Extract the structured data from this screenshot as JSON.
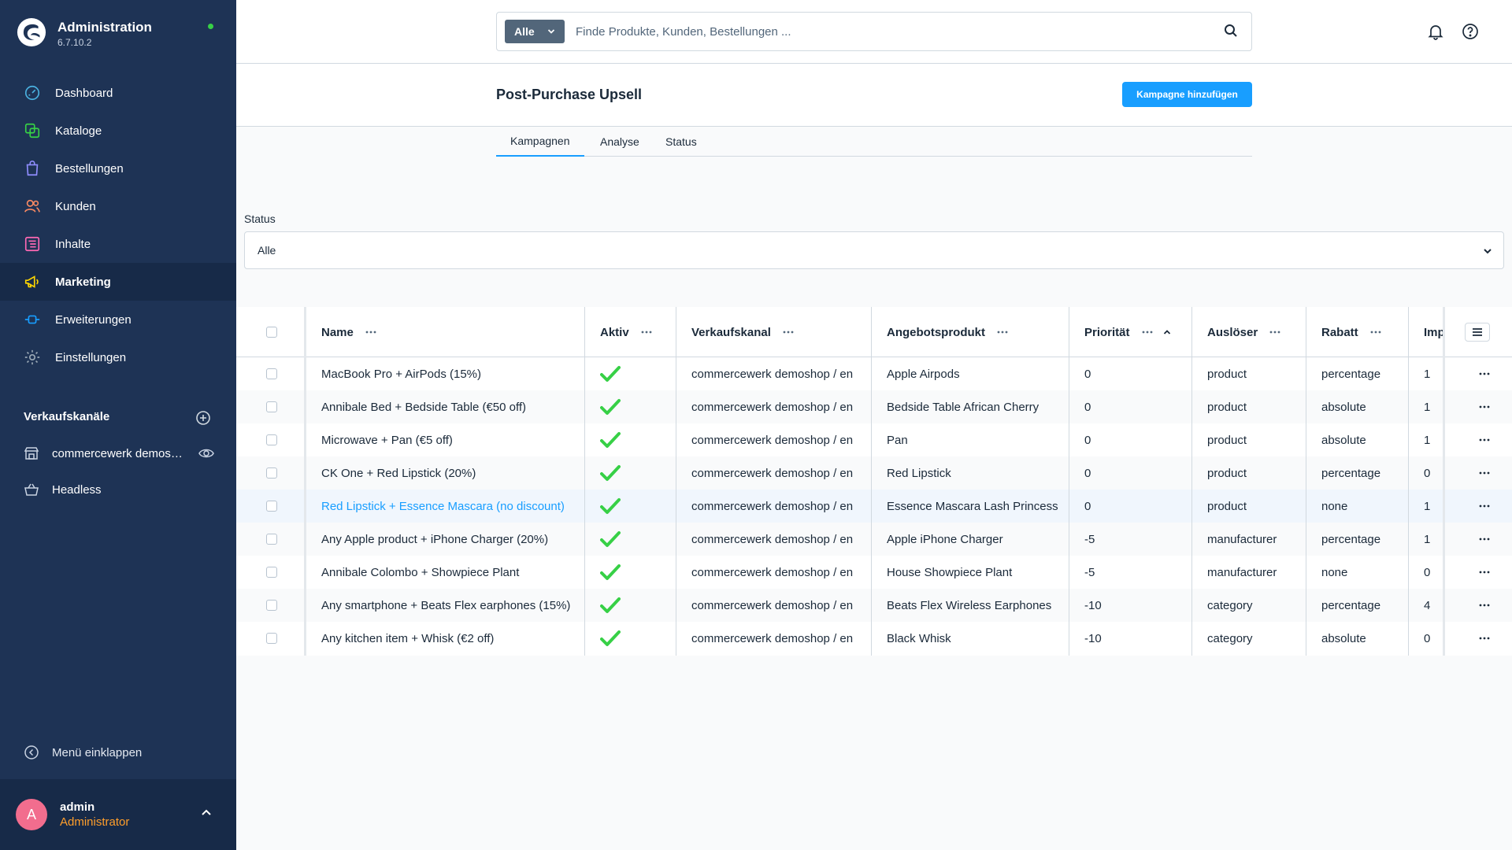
{
  "brand": {
    "title": "Administration",
    "version": "6.7.10.2"
  },
  "nav": [
    {
      "label": "Dashboard",
      "icon": "dashboard-icon",
      "color": "#4ab1e0"
    },
    {
      "label": "Kataloge",
      "icon": "catalog-icon",
      "color": "#37d046"
    },
    {
      "label": "Bestellungen",
      "icon": "orders-icon",
      "color": "#8f8dff"
    },
    {
      "label": "Kunden",
      "icon": "customers-icon",
      "color": "#f88962"
    },
    {
      "label": "Inhalte",
      "icon": "content-icon",
      "color": "#ff68b4"
    },
    {
      "label": "Marketing",
      "icon": "megaphone-icon",
      "color": "#ffd700"
    },
    {
      "label": "Erweiterungen",
      "icon": "plug-icon",
      "color": "#189eff"
    },
    {
      "label": "Einstellungen",
      "icon": "gear-icon",
      "color": "#9aa8b5"
    }
  ],
  "sales_channels": {
    "heading": "Verkaufskanäle",
    "items": [
      {
        "label": "commercewerk demos…",
        "icon": "storefront-icon"
      },
      {
        "label": "Headless",
        "icon": "basket-icon"
      }
    ]
  },
  "collapse_label": "Menü einklappen",
  "user": {
    "initial": "A",
    "name": "admin",
    "role": "Administrator"
  },
  "search": {
    "type": "Alle",
    "placeholder": "Finde Produkte, Kunden, Bestellungen ..."
  },
  "page": {
    "title": "Post-Purchase Upsell",
    "add_button": "Kampagne hinzufügen"
  },
  "tabs": [
    "Kampagnen",
    "Analyse",
    "Status"
  ],
  "filter": {
    "label": "Status",
    "value": "Alle"
  },
  "table": {
    "columns": [
      "Name",
      "Aktiv",
      "Verkaufskanal",
      "Angebotsprodukt",
      "Priorität",
      "Auslöser",
      "Rabatt",
      "Imp"
    ],
    "rows": [
      {
        "name": "MacBook Pro + AirPods (15%)",
        "active": true,
        "channel": "commercewerk demoshop / en",
        "product": "Apple Airpods",
        "priority": "0",
        "trigger": "product",
        "discount": "percentage",
        "imp": "1"
      },
      {
        "name": "Annibale Bed + Bedside Table (€50 off)",
        "active": true,
        "channel": "commercewerk demoshop / en",
        "product": "Bedside Table African Cherry",
        "priority": "0",
        "trigger": "product",
        "discount": "absolute",
        "imp": "1"
      },
      {
        "name": "Microwave + Pan (€5 off)",
        "active": true,
        "channel": "commercewerk demoshop / en",
        "product": "Pan",
        "priority": "0",
        "trigger": "product",
        "discount": "absolute",
        "imp": "1"
      },
      {
        "name": "CK One + Red Lipstick (20%)",
        "active": true,
        "channel": "commercewerk demoshop / en",
        "product": "Red Lipstick",
        "priority": "0",
        "trigger": "product",
        "discount": "percentage",
        "imp": "0"
      },
      {
        "name": "Red Lipstick + Essence Mascara (no discount)",
        "active": true,
        "channel": "commercewerk demoshop / en",
        "product": "Essence Mascara Lash Princess",
        "priority": "0",
        "trigger": "product",
        "discount": "none",
        "imp": "1"
      },
      {
        "name": "Any Apple product + iPhone Charger (20%)",
        "active": true,
        "channel": "commercewerk demoshop / en",
        "product": "Apple iPhone Charger",
        "priority": "-5",
        "trigger": "manufacturer",
        "discount": "percentage",
        "imp": "1"
      },
      {
        "name": "Annibale Colombo + Showpiece Plant",
        "active": true,
        "channel": "commercewerk demoshop / en",
        "product": "House Showpiece Plant",
        "priority": "-5",
        "trigger": "manufacturer",
        "discount": "none",
        "imp": "0"
      },
      {
        "name": "Any smartphone + Beats Flex earphones (15%)",
        "active": true,
        "channel": "commercewerk demoshop / en",
        "product": "Beats Flex Wireless Earphones",
        "priority": "-10",
        "trigger": "category",
        "discount": "percentage",
        "imp": "4"
      },
      {
        "name": "Any kitchen item + Whisk (€2 off)",
        "active": true,
        "channel": "commercewerk demoshop / en",
        "product": "Black Whisk",
        "priority": "-10",
        "trigger": "category",
        "discount": "absolute",
        "imp": "0"
      }
    ]
  },
  "colors": {
    "sidebar": "#1e3355",
    "accent": "#189eff",
    "success": "#37d046",
    "role": "#ff9e2b",
    "avatar": "#f26d8e"
  }
}
